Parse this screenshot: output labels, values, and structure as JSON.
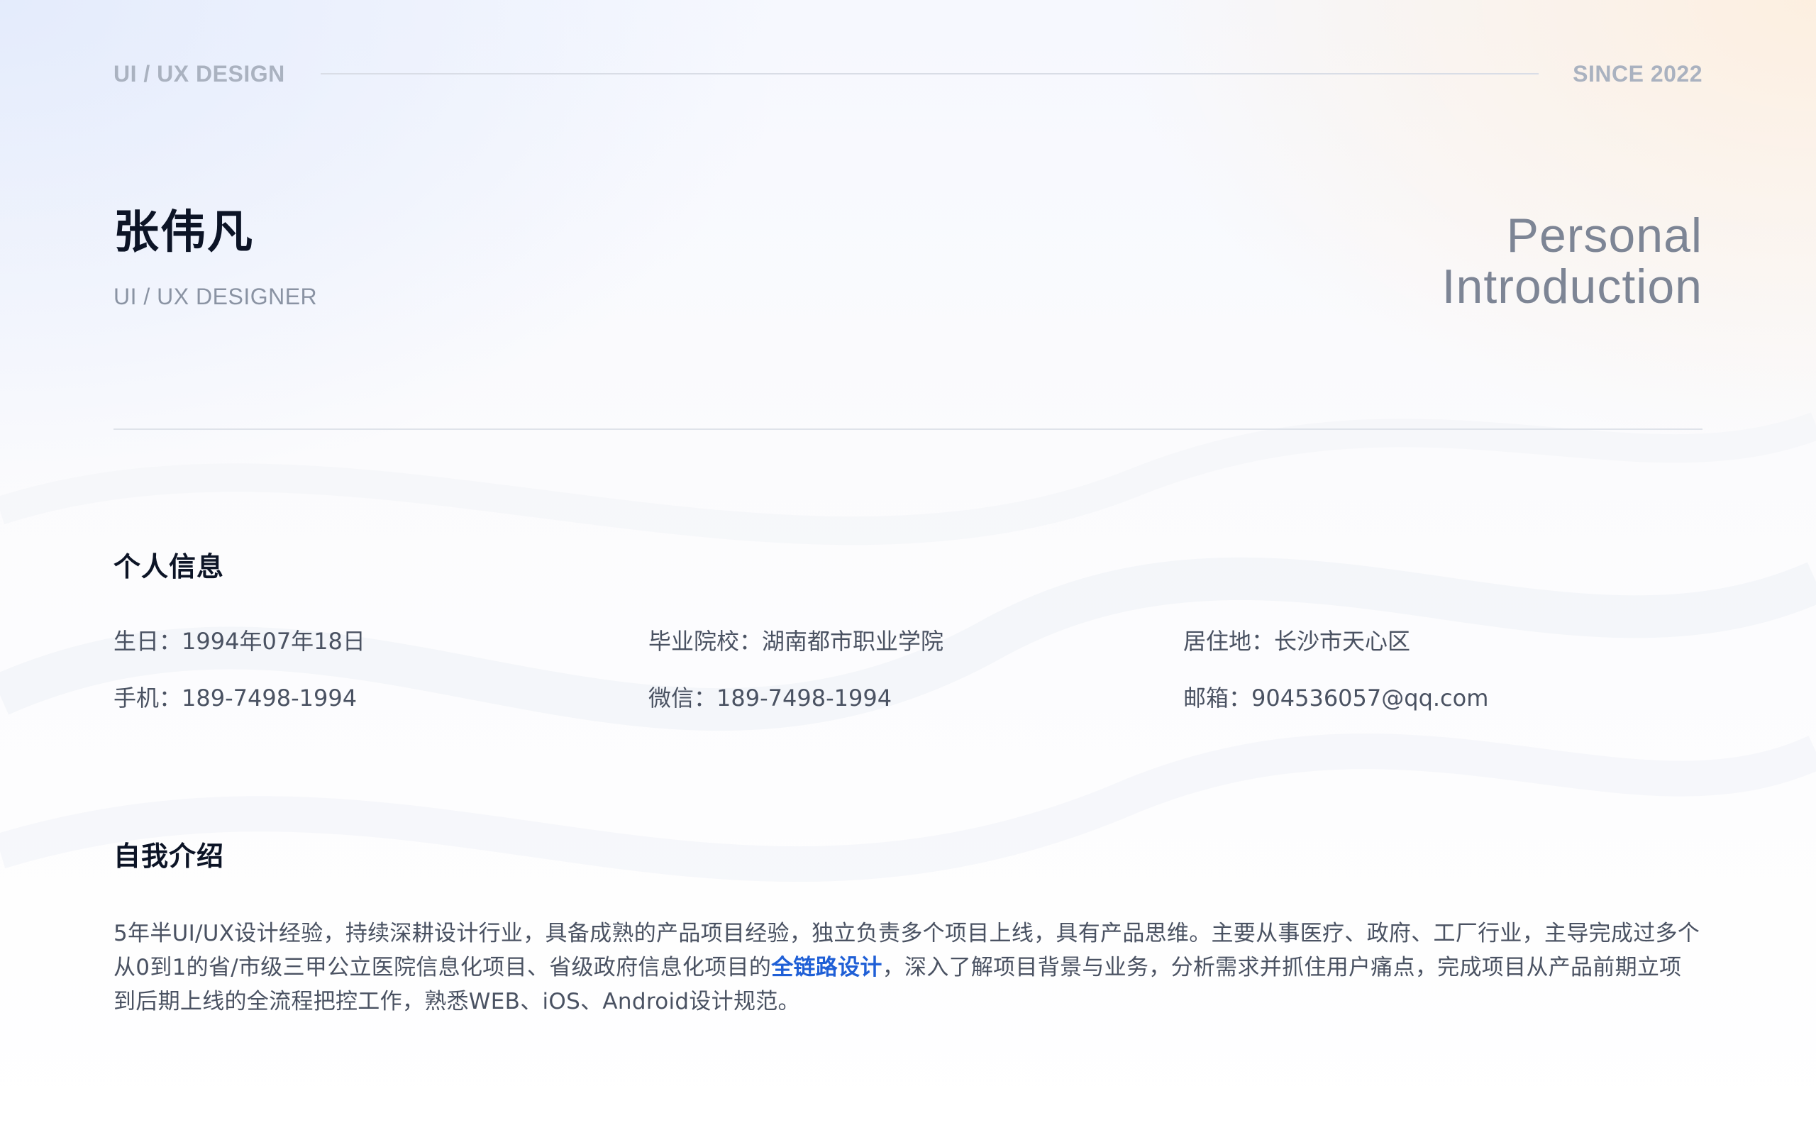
{
  "header": {
    "left_tag": "UI / UX DESIGN",
    "right_tag": "SINCE 2022"
  },
  "profile": {
    "name": "张伟凡",
    "role": "UI / UX DESIGNER",
    "title_line1": "Personal",
    "title_line2": "Introduction"
  },
  "personal_info": {
    "heading": "个人信息",
    "items": [
      {
        "label": "生日：",
        "value": "1994年07年18日"
      },
      {
        "label": "毕业院校：",
        "value": "湖南都市职业学院"
      },
      {
        "label": "居住地：",
        "value": "长沙市天心区"
      },
      {
        "label": "手机：",
        "value": "189-7498-1994"
      },
      {
        "label": "微信：",
        "value": "189-7498-1994"
      },
      {
        "label": "邮箱：",
        "value": "904536057@qq.com"
      }
    ]
  },
  "about": {
    "heading": "自我介绍",
    "text_before": "5年半UI/UX设计经验，持续深耕设计行业，具备成熟的产品项目经验，独立负责多个项目上线，具有产品思维。主要从事医疗、政府、工厂行业，主导完成过多个从0到1的省/市级三甲公立医院信息化项目、省级政府信息化项目的",
    "highlight": "全链路设计",
    "text_after": "，深入了解项目背景与业务，分析需求并抓住用户痛点，完成项目从产品前期立项到后期上线的全流程把控工作，熟悉WEB、iOS、Android设计规范。"
  },
  "colors": {
    "accent": "#1f5fd6",
    "heading": "#0c1426",
    "muted": "#aab2c0",
    "body_text": "#4a5262"
  }
}
